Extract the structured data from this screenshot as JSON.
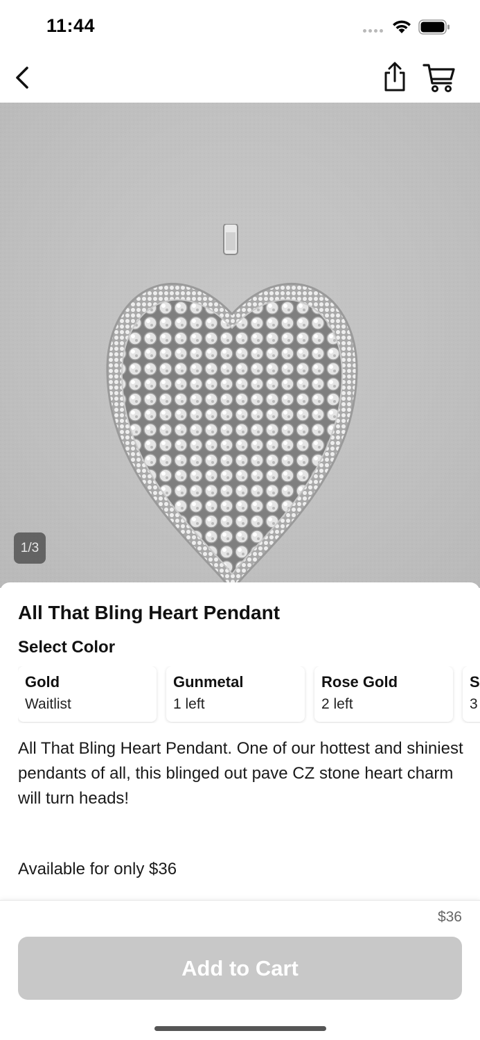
{
  "status_bar": {
    "time": "11:44",
    "icons": [
      "signal-dots-icon",
      "wifi-icon",
      "battery-icon"
    ]
  },
  "nav": {
    "icons": [
      "chevron-left-icon",
      "share-icon",
      "cart-icon"
    ]
  },
  "gallery": {
    "page_indicator": "1/3",
    "background_color": "#c4c4c4"
  },
  "product": {
    "title": "All That Bling Heart Pendant",
    "select_color_label": "Select Color",
    "colors": [
      {
        "name": "Gold",
        "stock": "Waitlist"
      },
      {
        "name": "Gunmetal",
        "stock": "1 left"
      },
      {
        "name": "Rose Gold",
        "stock": "2 left"
      },
      {
        "name": "Si",
        "stock": "3"
      }
    ],
    "description": "All That Bling Heart Pendant. One of our hottest and shiniest pendants of all, this blinged out pave CZ stone heart charm will turn heads!",
    "availability": "Available for only $36"
  },
  "footer": {
    "price": "$36",
    "add_to_cart_label": "Add to Cart",
    "button_color": "#c8c8c8"
  }
}
